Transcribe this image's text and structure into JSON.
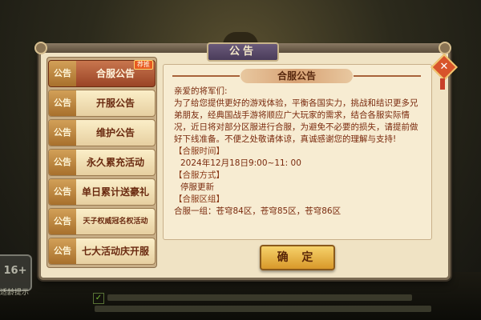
{
  "window": {
    "title": "公告",
    "close_glyph": "✕"
  },
  "tabs": [
    {
      "tag": "公告",
      "label": "合服公告",
      "active": true,
      "badge": "荐推"
    },
    {
      "tag": "公告",
      "label": "开服公告"
    },
    {
      "tag": "公告",
      "label": "维护公告"
    },
    {
      "tag": "公告",
      "label": "永久累充活动"
    },
    {
      "tag": "公告",
      "label": "单日累计送豪礼"
    },
    {
      "tag": "公告",
      "label": "天子权威冠名权活动"
    },
    {
      "tag": "公告",
      "label": "七大活动庆开服"
    }
  ],
  "content": {
    "header": "合服公告",
    "greeting": "亲爱的将军们:",
    "paragraph": "为了给您提供更好的游戏体验，平衡各国实力，挑战和结识更多兄弟朋友，经典国战手游将顺应广大玩家的需求，结合各服实际情况，近日将对部分区服进行合服，为避免不必要的损失，请提前做好下线准备。不便之处敬请体谅，真诚感谢您的理解与支持!",
    "time_label": "【合服时间】",
    "time_value": "2024年12月18日9:00~11: 00",
    "method_label": "【合服方式】",
    "method_value": "停服更新",
    "group_label": "【合服区组】",
    "group_value": "合服一组：苍穹84区，苍穹85区，苍穹86区"
  },
  "confirm_label": "确 定",
  "background": {
    "badge": "16+",
    "small_text": "适龄提示"
  },
  "colors": {
    "active_tab": "#b05a34",
    "text": "#7a2a0e",
    "panel": "#f0e3c4",
    "button": "#e8b448"
  }
}
